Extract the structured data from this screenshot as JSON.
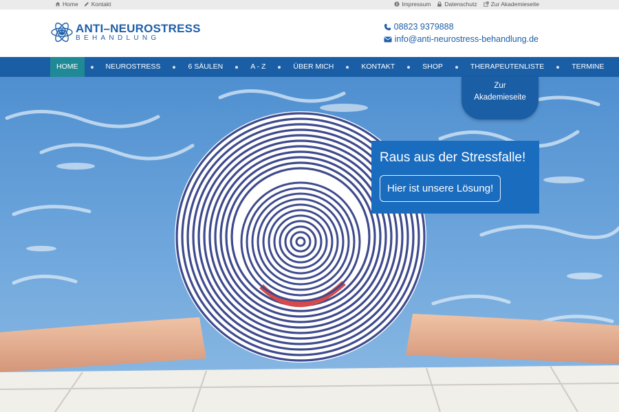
{
  "topbar": {
    "left_links": [
      {
        "label": "Home",
        "icon": "home-icon"
      },
      {
        "label": "Kontakt",
        "icon": "pencil-icon"
      }
    ],
    "right_links": [
      {
        "label": "Impressum",
        "icon": "info-icon"
      },
      {
        "label": "Datenschutz",
        "icon": "lock-icon"
      },
      {
        "label": "Zur Akademieseite",
        "icon": "external-link-icon"
      }
    ]
  },
  "header": {
    "logo_title": "ANTI–NEUROSTRESS",
    "logo_subtitle": "BEHANDLUNG",
    "phone": "08823 9379888",
    "email": "info@anti-neurostress-behandlung.de"
  },
  "nav": {
    "items": [
      "HOME",
      "NEUROSTRESS",
      "6 SÄULEN",
      "A - Z",
      "ÜBER MICH",
      "KONTAKT",
      "SHOP",
      "THERAPEUTENLISTE",
      "TERMINE"
    ],
    "active": "HOME"
  },
  "academy_tab": {
    "line1": "Zur",
    "line2": "Akademieseite"
  },
  "cta": {
    "title": "Raus aus der Stressfalle!",
    "button": "Hier ist unsere Lösung!"
  },
  "colors": {
    "brand_blue": "#1a5ea5",
    "active_teal": "#1f8a96",
    "cta_blue": "#1a6cbf",
    "topbar_gray": "#ebebeb"
  }
}
